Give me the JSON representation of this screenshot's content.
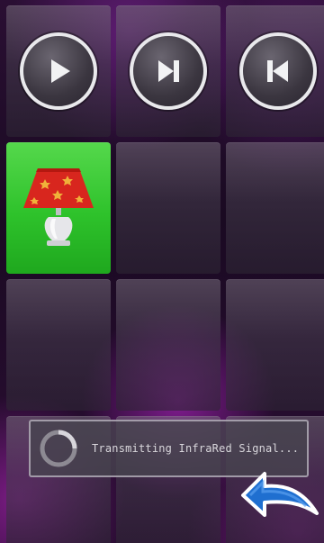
{
  "tiles": {
    "play": {
      "label": "",
      "icon": "play-icon"
    },
    "next": {
      "label": "",
      "icon": "skip-next-icon"
    },
    "previous": {
      "label": "",
      "icon": "skip-previous-icon"
    },
    "lamp": {
      "icon": "lamp-icon",
      "color": "#35c22f"
    }
  },
  "toast": {
    "message": "Transmitting InfraRed Signal...",
    "icon": "spinner-icon"
  },
  "back": {
    "icon": "back-arrow-icon",
    "color": "#1f6fd0"
  },
  "colors": {
    "tile": "#4a4350",
    "accent_green": "#35c22f",
    "accent_purple": "#c828dc"
  }
}
